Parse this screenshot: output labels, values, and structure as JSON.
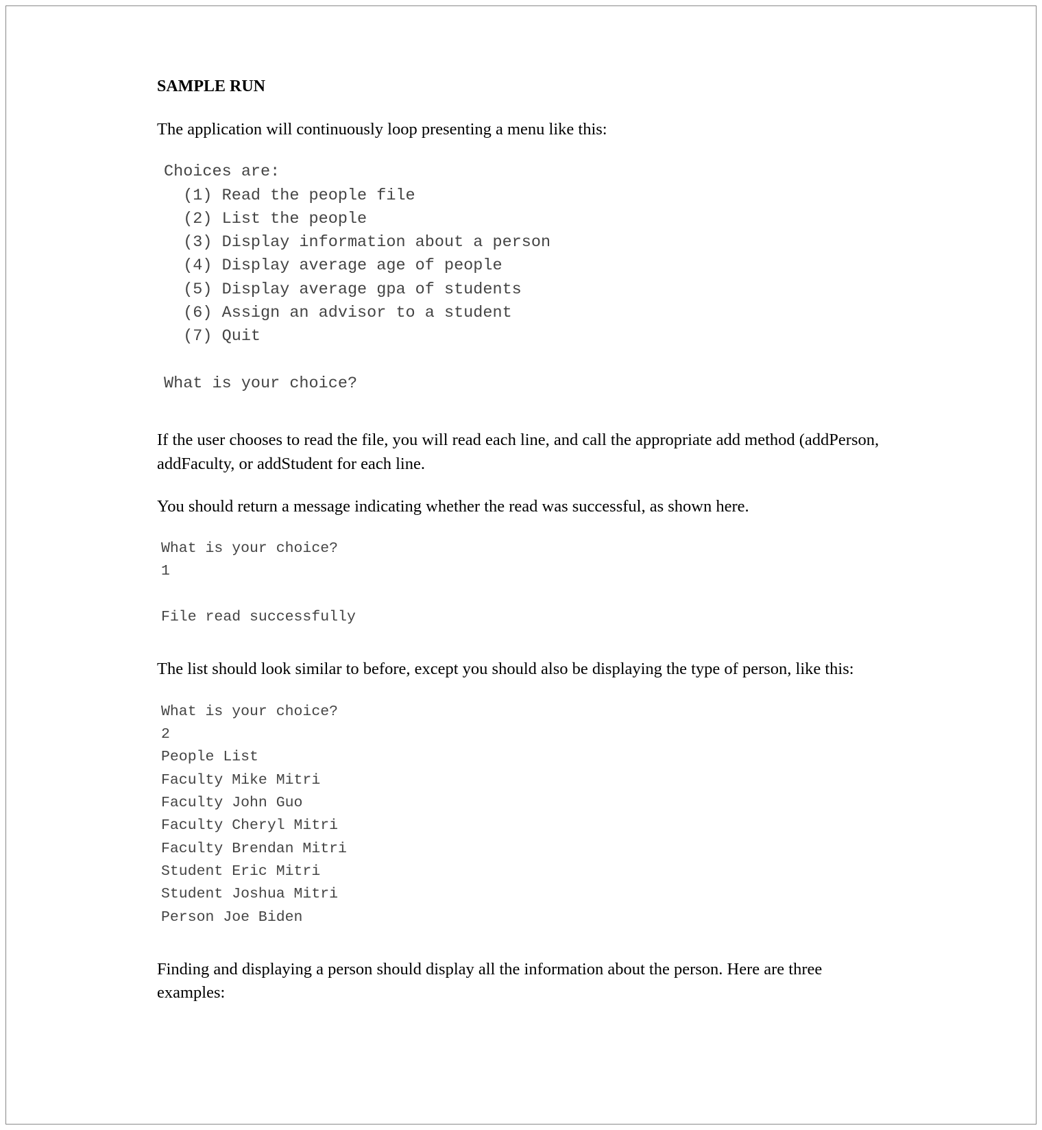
{
  "heading": "SAMPLE RUN",
  "para1": "The application will continuously loop presenting a menu like this:",
  "code1": "Choices are:\n  (1) Read the people file\n  (2) List the people\n  (3) Display information about a person\n  (4) Display average age of people\n  (5) Display average gpa of students\n  (6) Assign an advisor to a student\n  (7) Quit\n\nWhat is your choice?",
  "para2": "If the user chooses to read the file, you will read each line, and call the appropriate add method (addPerson, addFaculty, or addStudent for each line.",
  "para3": "You should return a message indicating whether the read was successful, as shown here.",
  "code2": "What is your choice?\n1\n\nFile read successfully",
  "para4": "The list should look similar to before, except you should also be displaying the type of person, like this:",
  "code3": "What is your choice?\n2\nPeople List\nFaculty Mike Mitri\nFaculty John Guo\nFaculty Cheryl Mitri\nFaculty Brendan Mitri\nStudent Eric Mitri\nStudent Joshua Mitri\nPerson Joe Biden",
  "para5": "Finding and displaying a person should display all the information about the person. Here are three examples:"
}
